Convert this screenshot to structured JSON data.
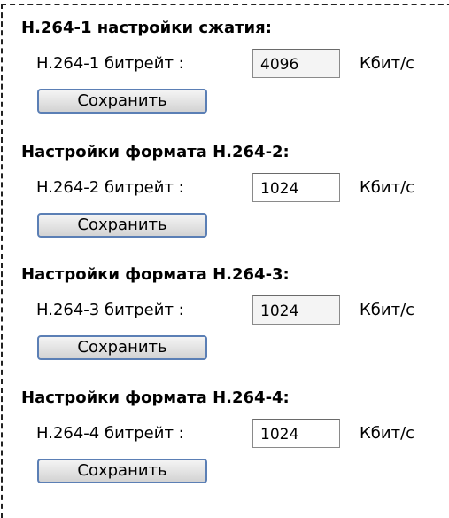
{
  "sections": [
    {
      "title": "H.264-1 настройки сжатия:",
      "label": "H.264-1 битрейт :",
      "value": "4096",
      "unit": "Кбит/с",
      "button": "Сохранить"
    },
    {
      "title": "Настройки формата H.264-2:",
      "label": "H.264-2 битрейт :",
      "value": "1024",
      "unit": "Кбит/с",
      "button": "Сохранить"
    },
    {
      "title": "Настройки формата H.264-3:",
      "label": "H.264-3 битрейт :",
      "value": "1024",
      "unit": "Кбит/с",
      "button": "Сохранить"
    },
    {
      "title": "Настройки формата H.264-4:",
      "label": "H.264-4 битрейт :",
      "value": "1024",
      "unit": "Кбит/с",
      "button": "Сохранить"
    }
  ]
}
